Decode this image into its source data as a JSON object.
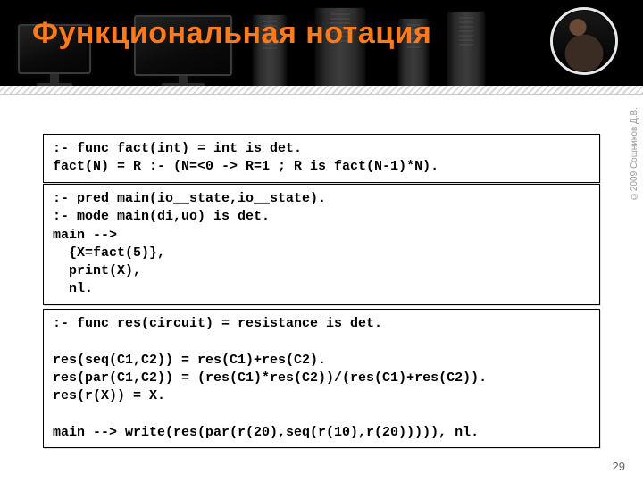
{
  "title": "Функциональная нотация",
  "copyright": "©2009  Сошников Д.В.",
  "page_number": "29",
  "code_blocks": {
    "fact": ":- func fact(int) = int is det.\nfact(N) = R :- (N=<0 -> R=1 ; R is fact(N-1)*N).",
    "main": ":- pred main(io__state,io__state).\n:- mode main(di,uo) is det.\nmain -->\n  {X=fact(5)},\n  print(X),\n  nl.",
    "res": ":- func res(circuit) = resistance is det.\n\nres(seq(C1,C2)) = res(C1)+res(C2).\nres(par(C1,C2)) = (res(C1)*res(C2))/(res(C1)+res(C2)).\nres(r(X)) = X.\n\nmain --> write(res(par(r(20),seq(r(10),r(20))))), nl."
  }
}
